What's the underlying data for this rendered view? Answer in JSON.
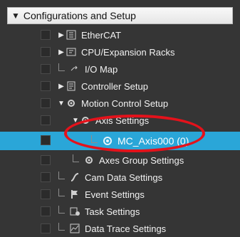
{
  "header": {
    "title": "Configurations and Setup",
    "expanded_arrow": "▼"
  },
  "tree": [
    {
      "label": "EtherCAT",
      "icon": "ethercat-icon",
      "arrow": "▶"
    },
    {
      "label": "CPU/Expansion Racks",
      "icon": "cpu-racks-icon",
      "arrow": "▶"
    },
    {
      "label": "I/O Map",
      "icon": "io-map-icon",
      "arrow": ""
    },
    {
      "label": "Controller Setup",
      "icon": "controller-setup-icon",
      "arrow": "▶"
    },
    {
      "label": "Motion Control Setup",
      "icon": "gear-icon",
      "arrow": "▼"
    },
    {
      "label": "Axis Settings",
      "icon": "gear-icon",
      "arrow": "▼"
    },
    {
      "label": "MC_Axis000 (0)",
      "icon": "gear-icon",
      "arrow": ""
    },
    {
      "label": "Axes Group Settings",
      "icon": "gear-icon",
      "arrow": ""
    },
    {
      "label": "Cam Data Settings",
      "icon": "cam-icon",
      "arrow": ""
    },
    {
      "label": "Event Settings",
      "icon": "event-flag-icon",
      "arrow": ""
    },
    {
      "label": "Task Settings",
      "icon": "task-icon",
      "arrow": ""
    },
    {
      "label": "Data Trace Settings",
      "icon": "data-trace-icon",
      "arrow": ""
    }
  ],
  "colors": {
    "selection": "#2aa6d8",
    "highlight": "#e4121b"
  }
}
